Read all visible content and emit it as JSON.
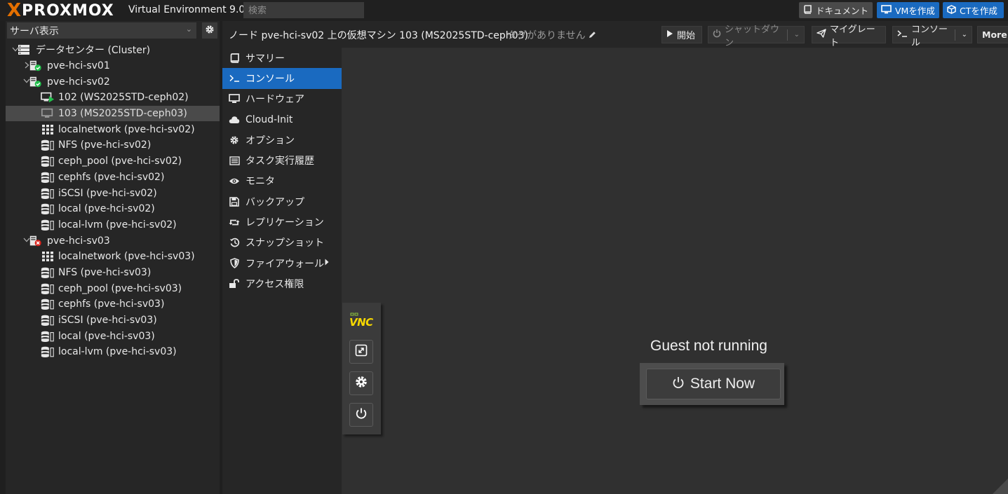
{
  "topbar": {
    "logo_x": "X",
    "logo_word": "PROXMOX",
    "version": "Virtual Environment 9.0.9",
    "search_placeholder": "検索",
    "docs_label": "ドキュメント",
    "create_vm_label": "VMを作成",
    "create_ct_label": "CTを作成"
  },
  "left": {
    "view_label": "サーバ表示",
    "tree": [
      {
        "label": "データセンター (Cluster)",
        "icon": "datacenter-icon",
        "expander": "open"
      },
      {
        "label": "pve-hci-sv01",
        "icon": "node-online-icon",
        "expander": "closed"
      },
      {
        "label": "pve-hci-sv02",
        "icon": "node-online-icon",
        "expander": "open"
      },
      {
        "label": "102 (WS2025STD-ceph02)",
        "icon": "vm-running-icon"
      },
      {
        "label": "103 (MS2025STD-ceph03)",
        "icon": "vm-stopped-icon",
        "selected": true
      },
      {
        "label": "localnetwork (pve-hci-sv02)",
        "icon": "network-grid-icon"
      },
      {
        "label": "NFS (pve-hci-sv02)",
        "icon": "storage-icon"
      },
      {
        "label": "ceph_pool (pve-hci-sv02)",
        "icon": "storage-icon"
      },
      {
        "label": "cephfs (pve-hci-sv02)",
        "icon": "storage-icon"
      },
      {
        "label": "iSCSI (pve-hci-sv02)",
        "icon": "storage-icon"
      },
      {
        "label": "local (pve-hci-sv02)",
        "icon": "storage-icon"
      },
      {
        "label": "local-lvm (pve-hci-sv02)",
        "icon": "storage-icon"
      },
      {
        "label": "pve-hci-sv03",
        "icon": "node-offline-icon",
        "expander": "open"
      },
      {
        "label": "localnetwork (pve-hci-sv03)",
        "icon": "network-grid-icon"
      },
      {
        "label": "NFS (pve-hci-sv03)",
        "icon": "storage-icon"
      },
      {
        "label": "ceph_pool (pve-hci-sv03)",
        "icon": "storage-icon"
      },
      {
        "label": "cephfs (pve-hci-sv03)",
        "icon": "storage-icon"
      },
      {
        "label": "iSCSI (pve-hci-sv03)",
        "icon": "storage-icon"
      },
      {
        "label": "local (pve-hci-sv03)",
        "icon": "storage-icon"
      },
      {
        "label": "local-lvm (pve-hci-sv03)",
        "icon": "storage-icon"
      }
    ]
  },
  "header": {
    "title": "ノード pve-hci-sv02 上の仮想マシン 103 (MS2025STD-ceph03)",
    "tags": "タグがありません",
    "start_label": "開始",
    "shutdown_label": "シャットダウン",
    "migrate_label": "マイグレート",
    "console_label": "コンソール",
    "more_label": "More"
  },
  "nav": [
    {
      "label": "サマリー",
      "icon": "summary-icon"
    },
    {
      "label": "コンソール",
      "icon": "terminal-icon",
      "active": true
    },
    {
      "label": "ハードウェア",
      "icon": "monitor-icon"
    },
    {
      "label": "Cloud-Init",
      "icon": "cloud-icon"
    },
    {
      "label": "オプション",
      "icon": "gear-icon"
    },
    {
      "label": "タスク実行履歴",
      "icon": "list-icon"
    },
    {
      "label": "モニタ",
      "icon": "eye-icon"
    },
    {
      "label": "バックアップ",
      "icon": "floppy-icon"
    },
    {
      "label": "レプリケーション",
      "icon": "retweet-icon"
    },
    {
      "label": "スナップショット",
      "icon": "history-icon"
    },
    {
      "label": "ファイアウォール",
      "icon": "shield-icon",
      "submenu": true
    },
    {
      "label": "アクセス権限",
      "icon": "unlock-icon"
    }
  ],
  "console": {
    "vnc_logo": "VNC",
    "status": "Guest not running",
    "start_now_label": "Start Now"
  },
  "colors": {
    "accent": "#1a6ac0",
    "brand_orange": "#e57000",
    "ok_green": "#21bf4b",
    "error_red": "#d9231c"
  }
}
